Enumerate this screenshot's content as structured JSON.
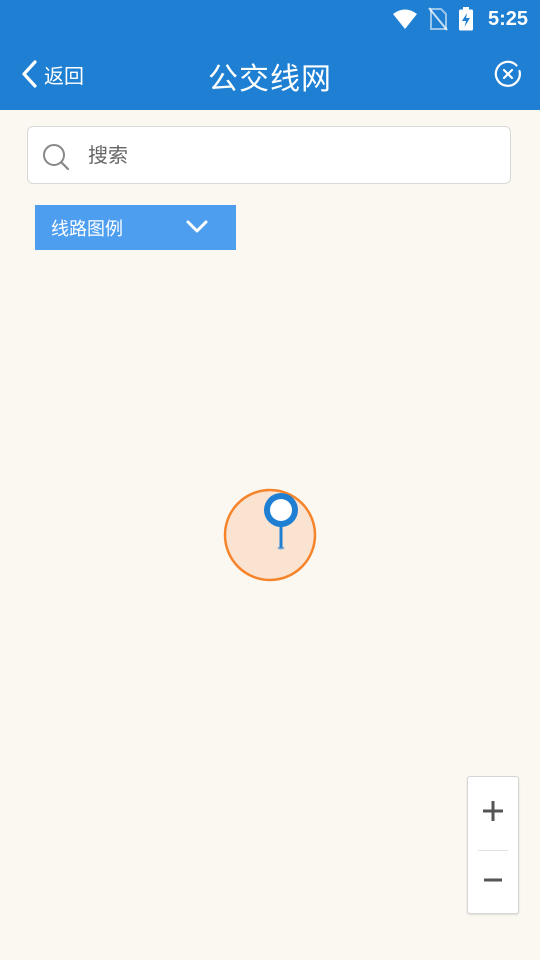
{
  "status_bar": {
    "time": "5:25",
    "icons": [
      "wifi-icon",
      "no-sim-icon",
      "battery-charging-icon"
    ]
  },
  "nav": {
    "back_label": "返回",
    "title": "公交线网",
    "close_icon": "close-circle-icon"
  },
  "search": {
    "placeholder": "搜索",
    "value": ""
  },
  "legend": {
    "label": "线路图例",
    "icon": "chevron-down-icon"
  },
  "map": {
    "marker_icon": "location-pin-icon",
    "zoom_in_icon": "plus-icon",
    "zoom_out_icon": "minus-icon"
  },
  "colors": {
    "header": "#1F7FD2",
    "map_background": "#FBF8F1",
    "legend_button": "#4E9EF0",
    "marker_ring": "#F5842A",
    "marker_fill": "#FBE3D2",
    "pin": "#1F7FD2"
  }
}
